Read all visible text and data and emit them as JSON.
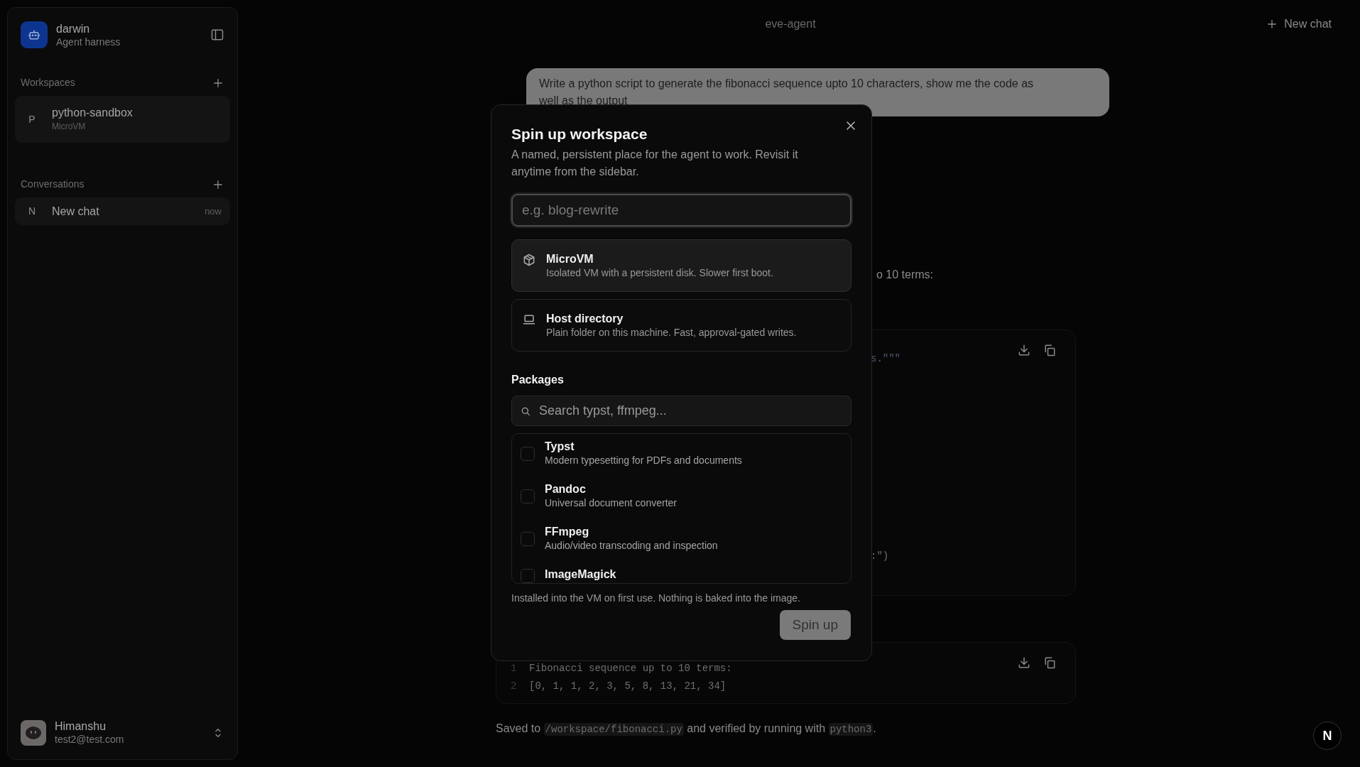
{
  "sidebar": {
    "brand": {
      "name": "darwin",
      "subtitle": "Agent harness"
    },
    "sections": [
      {
        "title": "Workspaces",
        "items": [
          {
            "initial": "P",
            "name": "python-sandbox",
            "detail": "MicroVM"
          }
        ]
      },
      {
        "title": "Conversations",
        "items": [
          {
            "initial": "N",
            "name": "New chat",
            "time": "now"
          }
        ]
      }
    ],
    "user": {
      "name": "Himanshu",
      "email": "test2@test.com"
    }
  },
  "header": {
    "title": "eve-agent",
    "new_chat": "New chat"
  },
  "chat": {
    "user_message": "Write a python script to generate the fibonacci sequence upto 10 characters, show me the code as well as the output",
    "assistant_fragment": "o 10 terms:",
    "code_blocks": [
      {
        "lines": [
          {
            "text": "s.\"\"\""
          },
          {
            "text": ":\")"
          }
        ]
      },
      {
        "lines": [
          {
            "number": "1",
            "text": "Fibonacci sequence up to 10 terms:"
          },
          {
            "number": "2",
            "text": "[0, 1, 1, 2, 3, 5, 8, 13, 21, 34]"
          }
        ]
      }
    ],
    "result": [
      {
        "kind": "text",
        "text": "Saved to "
      },
      {
        "kind": "code",
        "text": "/workspace/fibonacci.py"
      },
      {
        "kind": "text",
        "text": " and verified by running with "
      },
      {
        "kind": "code",
        "text": "python3"
      },
      {
        "kind": "text",
        "text": "."
      }
    ]
  },
  "dev_badge": "N",
  "modal": {
    "title": "Spin up workspace",
    "description": "A named, persistent place for the agent to work. Revisit it anytime from the sidebar.",
    "name_field": {
      "placeholder": "e.g. blog-rewrite"
    },
    "options": [
      {
        "kind": "microvm",
        "title": "MicroVM",
        "description": "Isolated VM with a persistent disk. Slower first boot.",
        "selected": true
      },
      {
        "kind": "host",
        "title": "Host directory",
        "description": "Plain folder on this machine. Fast, approval-gated writes.",
        "selected": false
      }
    ],
    "packages": {
      "heading": "Packages",
      "search": {
        "placeholder": "Search typst, ffmpeg..."
      },
      "items": [
        {
          "name": "Typst",
          "description": "Modern typesetting for PDFs and documents",
          "checked": false
        },
        {
          "name": "Pandoc",
          "description": "Universal document converter",
          "checked": false
        },
        {
          "name": "FFmpeg",
          "description": "Audio/video transcoding and inspection",
          "checked": false
        },
        {
          "name": "ImageMagick",
          "checked": false
        }
      ],
      "note": "Installed into the VM on first use. Nothing is baked into the image."
    },
    "submit": {
      "label": "Spin up",
      "disabled": true
    }
  }
}
